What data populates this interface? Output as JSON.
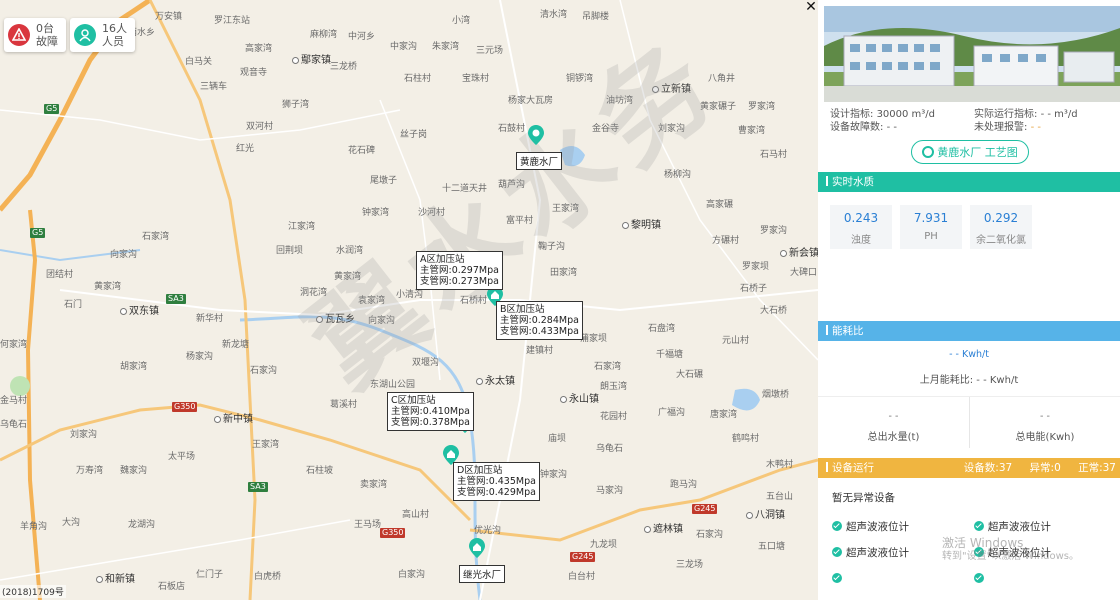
{
  "map": {
    "status_chips": [
      {
        "icon": "alarm-icon",
        "count": "0台",
        "label": "故障"
      },
      {
        "icon": "person-icon",
        "count": "16人",
        "label": "人员"
      }
    ],
    "places": [
      {
        "t": "万安镇"
      },
      {
        "t": "罗江东站"
      },
      {
        "t": "两水乡"
      },
      {
        "t": "高家湾"
      },
      {
        "t": "麻柳湾"
      },
      {
        "t": "鄢家镇"
      },
      {
        "t": "三龙桥"
      },
      {
        "t": "白马关"
      },
      {
        "t": "观音寺"
      },
      {
        "t": "三辆车"
      },
      {
        "t": "双河村"
      },
      {
        "t": "狮子湾"
      },
      {
        "t": "中河乡"
      },
      {
        "t": "中家沟"
      },
      {
        "t": "小湾"
      },
      {
        "t": "清水湾"
      },
      {
        "t": "吊脚楼"
      },
      {
        "t": "三元场"
      },
      {
        "t": "朱家湾"
      },
      {
        "t": "宝珠村"
      },
      {
        "t": "石柱村"
      },
      {
        "t": "铜锣湾"
      },
      {
        "t": "八角井"
      },
      {
        "t": "立新镇"
      },
      {
        "t": "杨家大瓦房"
      },
      {
        "t": "油坊湾"
      },
      {
        "t": "黄家碾子"
      },
      {
        "t": "罗家湾"
      },
      {
        "t": "石鼓村"
      },
      {
        "t": "金谷寺"
      },
      {
        "t": "刘家沟"
      },
      {
        "t": "曹家湾"
      },
      {
        "t": "红光"
      },
      {
        "t": "石马村"
      },
      {
        "t": "丝子岗"
      },
      {
        "t": "花石碑"
      },
      {
        "t": "尾墩子"
      },
      {
        "t": "十二道天井"
      },
      {
        "t": "葫芦沟"
      },
      {
        "t": "杨柳沟"
      },
      {
        "t": "高家碾"
      },
      {
        "t": "王家湾"
      },
      {
        "t": "黎明镇"
      },
      {
        "t": "方碾村"
      },
      {
        "t": "富平村"
      },
      {
        "t": "沙河村"
      },
      {
        "t": "钟家湾"
      },
      {
        "t": "江家湾"
      },
      {
        "t": "回荆坝"
      },
      {
        "t": "水润湾"
      },
      {
        "t": "罗家沟"
      },
      {
        "t": "新会镇"
      },
      {
        "t": "大碑口"
      },
      {
        "t": "罗家坝"
      },
      {
        "t": "鞠子沟"
      },
      {
        "t": "田家湾"
      },
      {
        "t": "石桥子"
      },
      {
        "t": "石桥村"
      },
      {
        "t": "小清沟"
      },
      {
        "t": "洞花湾"
      },
      {
        "t": "黄家湾"
      },
      {
        "t": "瓦瓦乡"
      },
      {
        "t": "袁家湾"
      },
      {
        "t": "大石桥"
      },
      {
        "t": "元山村"
      },
      {
        "t": "向家沟"
      },
      {
        "t": "千福塘"
      },
      {
        "t": "石盘湾"
      },
      {
        "t": "蒲家坝"
      },
      {
        "t": "建镇村"
      },
      {
        "t": "永太镇"
      },
      {
        "t": "双堰沟"
      },
      {
        "t": "石家湾"
      },
      {
        "t": "大石碾"
      },
      {
        "t": "新华村"
      },
      {
        "t": "新龙塘"
      },
      {
        "t": "杨家沟"
      },
      {
        "t": "石家沟"
      },
      {
        "t": "石家湾"
      },
      {
        "t": "双东镇"
      },
      {
        "t": "胡家湾"
      },
      {
        "t": "永山镇"
      },
      {
        "t": "鹤鸣村"
      },
      {
        "t": "花园村"
      },
      {
        "t": "乌龟石"
      },
      {
        "t": "广福沟"
      },
      {
        "t": "朗玉湾"
      },
      {
        "t": "新中镇"
      },
      {
        "t": "王家湾"
      },
      {
        "t": "刘家沟"
      },
      {
        "t": "魏家沟"
      },
      {
        "t": "万寿湾"
      },
      {
        "t": "石柱坡"
      },
      {
        "t": "白虎桥"
      },
      {
        "t": "太平场"
      },
      {
        "t": "羊角沟"
      },
      {
        "t": "龙湖沟"
      },
      {
        "t": "大沟"
      },
      {
        "t": "和新镇"
      },
      {
        "t": "石板店"
      },
      {
        "t": "王马场"
      },
      {
        "t": "仁门子"
      },
      {
        "t": "卖家湾"
      },
      {
        "t": "白家沟"
      },
      {
        "t": "优光沟"
      },
      {
        "t": "高山村"
      },
      {
        "t": "白台村"
      },
      {
        "t": "三龙场"
      },
      {
        "t": "五口塘"
      },
      {
        "t": "八洞镇"
      },
      {
        "t": "九龙坝"
      },
      {
        "t": "石家沟"
      },
      {
        "t": "遮林镇"
      },
      {
        "t": "马家沟"
      },
      {
        "t": "钟家沟"
      },
      {
        "t": "庙坝"
      },
      {
        "t": "跑马沟"
      },
      {
        "t": "五台山"
      },
      {
        "t": "木鸭村"
      },
      {
        "t": "乌龟石"
      },
      {
        "t": "唐家湾"
      },
      {
        "t": "烟墩桥"
      },
      {
        "t": "金马村"
      },
      {
        "t": "东湖山公园"
      },
      {
        "t": "向家沟"
      },
      {
        "t": "团结村"
      },
      {
        "t": "黄家湾"
      },
      {
        "t": "何家湾"
      },
      {
        "t": "石门"
      },
      {
        "t": "葛溪村"
      },
      {
        "t": "寨子湾"
      }
    ],
    "road_shields": [
      "G5",
      "G5",
      "SA3",
      "SA3",
      "G350",
      "G350",
      "G245",
      "G245"
    ],
    "watermark": "翼水水务",
    "stations": [
      {
        "title": "A区加压站",
        "main": "主管网:0.297Mpa",
        "branch": "支管网:0.273Mpa"
      },
      {
        "title": "B区加压站",
        "main": "主管网:0.284Mpa",
        "branch": "支管网:0.433Mpa"
      },
      {
        "title": "C区加压站",
        "main": "主管网:0.410Mpa",
        "branch": "支管网:0.378Mpa"
      },
      {
        "title": "D区加压站",
        "main": "主管网:0.435Mpa",
        "branch": "支管网:0.429Mpa"
      }
    ],
    "plants": [
      "黄鹿水厂",
      "继光水厂"
    ],
    "copyright": "(2018)1709号"
  },
  "panel": {
    "info": {
      "design_label": "设计指标:",
      "design_value": "30000 m³/d",
      "actual_label": "实际运行指标:",
      "actual_value": "- - m³/d",
      "fault_label": "设备故障数:",
      "fault_value": "- -",
      "alarm_label": "未处理报警:",
      "alarm_value": "- -"
    },
    "process_button": "黄鹿水厂 工艺图",
    "water_quality": {
      "title": "实时水质",
      "items": [
        {
          "value": "0.243",
          "name": "浊度"
        },
        {
          "value": "7.931",
          "name": "PH"
        },
        {
          "value": "0.292",
          "name": "余二氧化氯"
        }
      ]
    },
    "energy": {
      "title": "能耗比",
      "current": "- - Kwh/t",
      "last_month_label": "上月能耗比:",
      "last_month_value": "- - Kwh/t",
      "outflow_value": "- -",
      "outflow_label": "总出水量(t)",
      "power_value": "- -",
      "power_label": "总电能(Kwh)"
    },
    "devices": {
      "title": "设备运行",
      "total": "设备数:37",
      "abnormal": "异常:0",
      "normal": "正常:37",
      "no_abnormal": "暂无异常设备",
      "items": [
        "超声波液位计",
        "超声波液位计",
        "超声波液位计",
        "超声波液位计",
        "",
        ""
      ]
    },
    "windows_notice": {
      "line1": "激活 Windows",
      "line2": "转到\"设置\"以激活 Windows。"
    }
  },
  "colors": {
    "accent": "#1fbfa3",
    "blue": "#56b3e8",
    "orange": "#f0b540",
    "value_blue": "#2a7fd4"
  }
}
